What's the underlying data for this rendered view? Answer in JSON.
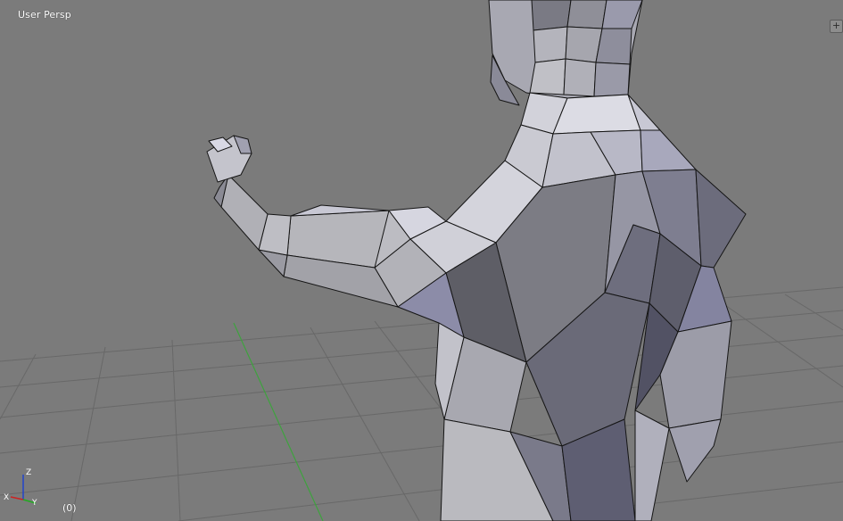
{
  "viewport": {
    "view_label": "User Persp",
    "frame_label": "(0)",
    "corner_widget": "+"
  },
  "axis_gizmo": {
    "x_label": "X",
    "y_label": "Y",
    "z_label": "Z",
    "colors": {
      "x": "#cc2222",
      "y": "#22aa22",
      "z": "#2244cc"
    }
  },
  "colors": {
    "background": "#7b7b7b",
    "grid_line": "#6a6a6a",
    "grid_axis_y": "#3ea23e",
    "mesh_edge": "#151515"
  }
}
